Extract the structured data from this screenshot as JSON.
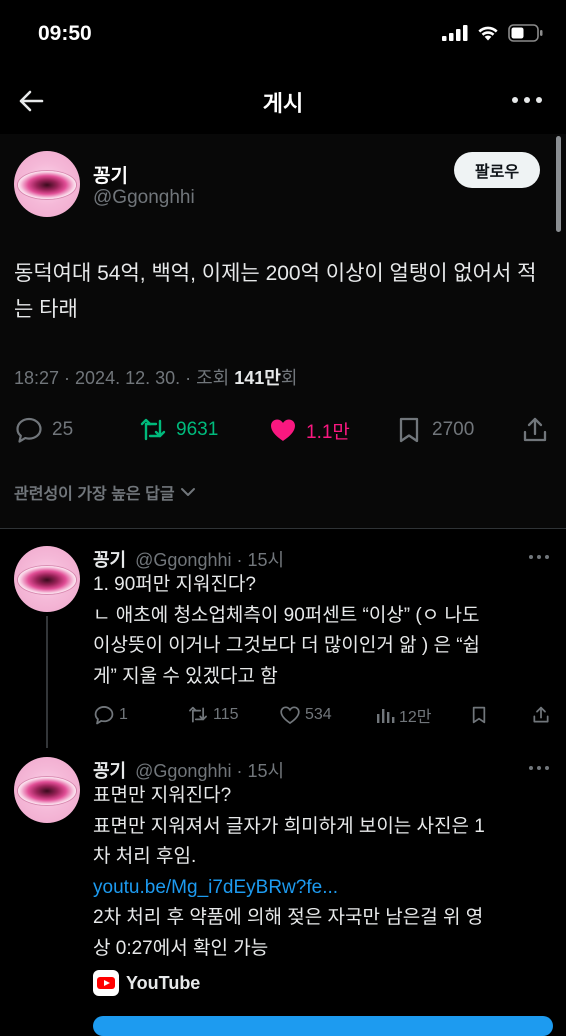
{
  "status_bar": {
    "time": "09:50"
  },
  "nav": {
    "title": "게시"
  },
  "post": {
    "name": "꽁기",
    "handle": "@Ggonghhi",
    "follow_label": "팔로우",
    "text": "동덕여대 54억, 백억, 이제는 200억 이상이 얼탱이 없어서 적는 타래",
    "meta_prefix": "18:27 · 2024. 12. 30. · 조회 ",
    "views": "141만",
    "views_suffix": "회",
    "stats": {
      "replies": "25",
      "reposts": "9631",
      "likes": "1.1만",
      "bookmarks": "2700"
    },
    "colors": {
      "repost": "#00ba7c",
      "like": "#f91880"
    }
  },
  "related_label": "관련성이 가장 높은 답글",
  "replies": [
    {
      "name": "꽁기",
      "handle": "@Ggonghhi",
      "time": "· 15시",
      "lines": [
        "1. 90퍼만 지워진다?",
        "ㄴ 애초에 청소업체측이 90퍼센트 “이상” (ㅇ 나도",
        "이상뜻이 이거나 그것보다 더 많이인거 앎 ) 은 “쉽",
        "게” 지울 수 있겠다고 함"
      ],
      "stats": {
        "replies": "1",
        "reposts": "115",
        "likes": "534",
        "views": "12만"
      }
    },
    {
      "name": "꽁기",
      "handle": "@Ggonghhi",
      "time": "· 15시",
      "lines": [
        "표면만 지워진다?",
        "표면만 지워져서 글자가 희미하게 보이는 사진은 1",
        "차 처리 후임."
      ],
      "link": "youtu.be/Mg_i7dEyBRw?fe...",
      "lines2": [
        "2차 처리 후 약품에 의해 젖은 자국만 남은걸 위 영",
        "상 0:27에서 확인 가능"
      ],
      "card_label": "YouTube"
    }
  ]
}
